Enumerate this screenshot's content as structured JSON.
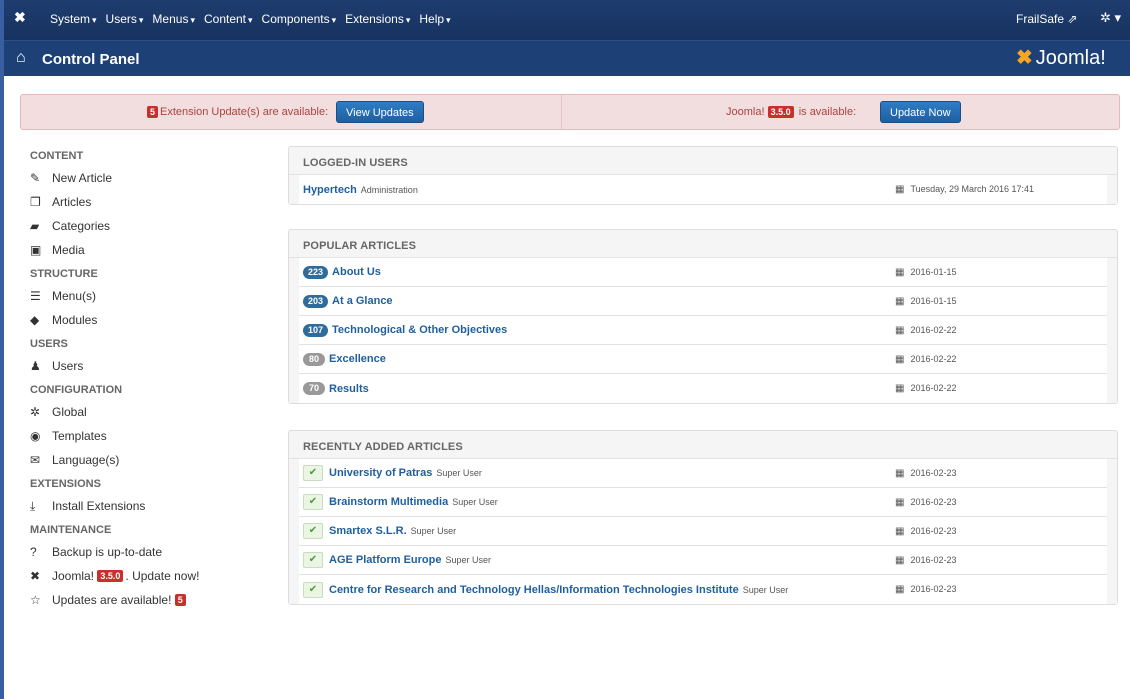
{
  "topnav": {
    "menu": [
      {
        "label": "System"
      },
      {
        "label": "Users"
      },
      {
        "label": "Menus"
      },
      {
        "label": "Content"
      },
      {
        "label": "Components"
      },
      {
        "label": "Extensions"
      },
      {
        "label": "Help"
      }
    ],
    "caret": "▾",
    "site_name": "FrailSafe",
    "site_icon": "⇗",
    "gear_icon": "✲ ▾"
  },
  "header": {
    "title": "Control Panel",
    "brand_text": "Joomla!"
  },
  "alert": {
    "ext_count": "5",
    "ext_text": "Extension Update(s) are available:",
    "ext_button": "View Updates",
    "joomla_prefix": "Joomla!",
    "joomla_version": "3.5.0",
    "joomla_suffix": "is available:",
    "joomla_button": "Update Now"
  },
  "sidebar": {
    "content_head": "CONTENT",
    "content": [
      "New Article",
      "Articles",
      "Categories",
      "Media"
    ],
    "structure_head": "STRUCTURE",
    "structure": [
      "Menu(s)",
      "Modules"
    ],
    "users_head": "USERS",
    "users": [
      "Users"
    ],
    "config_head": "CONFIGURATION",
    "config": [
      "Global",
      "Templates",
      "Language(s)"
    ],
    "extensions_head": "EXTENSIONS",
    "extensions": [
      "Install Extensions"
    ],
    "maintenance_head": "MAINTENANCE",
    "backup": "Backup is up-to-date",
    "joomla_prefix": "Joomla!",
    "joomla_version": "3.5.0",
    "joomla_suffix": ". Update now!",
    "updates_text": "Updates are available!",
    "updates_count": "5"
  },
  "logged_in": {
    "title": "LOGGED-IN USERS",
    "rows": [
      {
        "name": "Hypertech",
        "role": "Administration",
        "date": "Tuesday, 29 March 2016 17:41"
      }
    ]
  },
  "popular": {
    "title": "POPULAR ARTICLES",
    "rows": [
      {
        "hits": "223",
        "title": "About Us",
        "date": "2016-01-15",
        "style": "blue"
      },
      {
        "hits": "203",
        "title": "At a Glance",
        "date": "2016-01-15",
        "style": "blue"
      },
      {
        "hits": "107",
        "title": "Technological & Other Objectives",
        "date": "2016-02-22",
        "style": "blue"
      },
      {
        "hits": "80",
        "title": "Excellence",
        "date": "2016-02-22",
        "style": "gray"
      },
      {
        "hits": "70",
        "title": "Results",
        "date": "2016-02-22",
        "style": "gray"
      }
    ]
  },
  "recent": {
    "title": "RECENTLY ADDED ARTICLES",
    "rows": [
      {
        "title": "University of Patras",
        "author": "Super User",
        "date": "2016-02-23"
      },
      {
        "title": "Brainstorm Multimedia",
        "author": "Super User",
        "date": "2016-02-23"
      },
      {
        "title": "Smartex S.L.R.",
        "author": "Super User",
        "date": "2016-02-23"
      },
      {
        "title": "AGE Platform Europe",
        "author": "Super User",
        "date": "2016-02-23"
      },
      {
        "title": "Centre for Research and Technology Hellas/Information Technologies Institute",
        "author": "Super User",
        "date": "2016-02-23"
      }
    ]
  },
  "colors": {
    "nav_bg": "#1a3867",
    "header_bg": "#1d4176",
    "alert_bg": "#f2dede",
    "link": "#1f5f9f",
    "badge_red": "#c9302c"
  }
}
